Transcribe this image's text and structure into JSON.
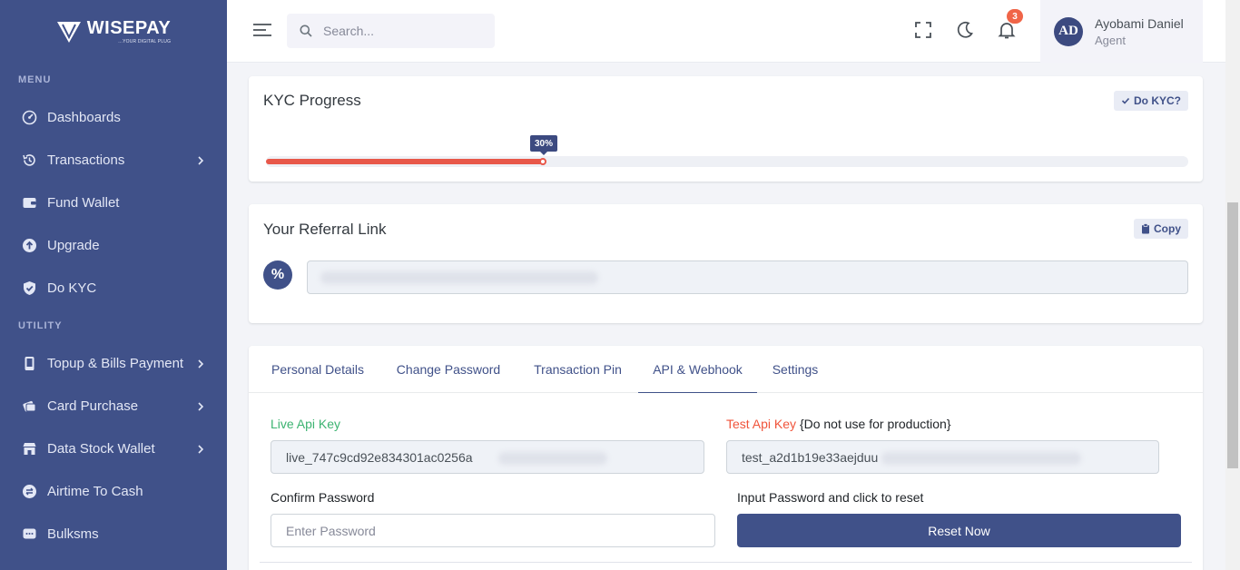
{
  "brand": {
    "name": "WISEPAY",
    "tagline": "...YOUR DIGITAL PLUG"
  },
  "sidebar": {
    "sections": [
      {
        "title": "MENU",
        "items": [
          {
            "label": "Dashboards",
            "icon": "dashboard-icon",
            "has_submenu": false
          },
          {
            "label": "Transactions",
            "icon": "history-icon",
            "has_submenu": true
          },
          {
            "label": "Fund Wallet",
            "icon": "wallet-icon",
            "has_submenu": false
          },
          {
            "label": "Upgrade",
            "icon": "upgrade-icon",
            "has_submenu": false
          },
          {
            "label": "Do KYC",
            "icon": "shield-icon",
            "has_submenu": false
          }
        ]
      },
      {
        "title": "UTILITY",
        "items": [
          {
            "label": "Topup & Bills Payment",
            "icon": "phone-icon",
            "has_submenu": true
          },
          {
            "label": "Card Purchase",
            "icon": "card-icon",
            "has_submenu": true
          },
          {
            "label": "Data Stock Wallet",
            "icon": "store-icon",
            "has_submenu": true
          },
          {
            "label": "Airtime To Cash",
            "icon": "exchange-icon",
            "has_submenu": false
          },
          {
            "label": "Bulksms",
            "icon": "chat-icon",
            "has_submenu": false
          }
        ]
      }
    ]
  },
  "topbar": {
    "search_placeholder": "Search...",
    "notification_count": "3",
    "user": {
      "initials": "AD",
      "name": "Ayobami Daniel",
      "role": "Agent"
    }
  },
  "kyc": {
    "title": "KYC Progress",
    "button": "Do KYC?",
    "progress": 0.3,
    "progress_label": "30%"
  },
  "referral": {
    "title": "Your Referral Link",
    "button": "Copy",
    "icon_symbol": "%"
  },
  "profile": {
    "tabs": [
      "Personal Details",
      "Change Password",
      "Transaction Pin",
      "API & Webhook",
      "Settings"
    ],
    "active_tab": 3,
    "live_key_label": "Live Api Key",
    "live_key_value": "live_747c9cd92e834301ac0256a",
    "test_key_label": "Test Api Key",
    "test_key_note": "{Do not use for production}",
    "test_key_value": "test_a2d1b19e33aejduu",
    "confirm_label": "Confirm Password",
    "confirm_placeholder": "Enter Password",
    "reset_label": "Input Password and click to reset",
    "reset_button": "Reset Now"
  },
  "colors": {
    "sidebar": "#405189",
    "accent": "#405189",
    "progress": "#e8584a",
    "badge": "#f06548",
    "live": "#3cb371",
    "test": "#f0543b"
  }
}
